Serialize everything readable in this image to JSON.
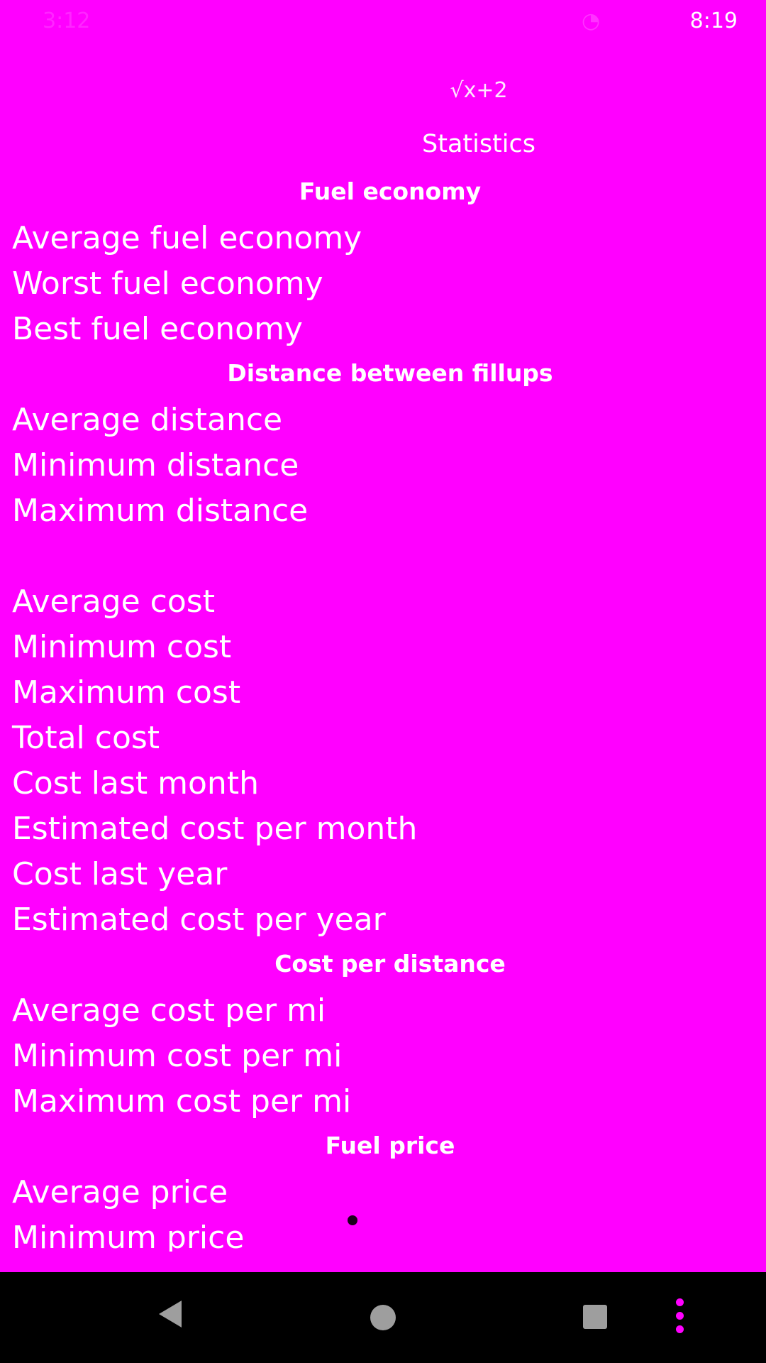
{
  "status_bar": {
    "time": "3:12",
    "clock": "8:19"
  },
  "header": {
    "app_title": "√x+2",
    "page_title": "Statistics"
  },
  "sections": [
    {
      "title": "Fuel economy",
      "rows": [
        "Average fuel economy",
        "Worst fuel economy",
        "Best fuel economy"
      ]
    },
    {
      "title": "Distance between fillups",
      "rows": [
        "Average distance",
        "Minimum distance",
        "Maximum distance"
      ]
    },
    {
      "title": "",
      "rows": [
        "Average cost",
        "Minimum cost",
        "Maximum cost",
        "Total cost",
        "Cost last month",
        "Estimated cost per month",
        "Cost last year",
        "Estimated cost per year"
      ]
    },
    {
      "title": "Cost per distance",
      "rows": [
        "Average cost per mi",
        "Minimum cost per mi",
        "Maximum cost per mi"
      ]
    },
    {
      "title": "Fuel price",
      "rows": [
        "Average price",
        "Minimum price"
      ]
    }
  ],
  "nav_bar": {
    "icons": [
      "back-icon",
      "home-icon",
      "recents-icon",
      "overflow-menu-icon"
    ]
  },
  "colors": {
    "background": "#ff00ff",
    "text": "#ffffff",
    "nav_background": "#000000",
    "nav_icon": "#9e9e9e",
    "menu_dots": "#ff00ff"
  }
}
